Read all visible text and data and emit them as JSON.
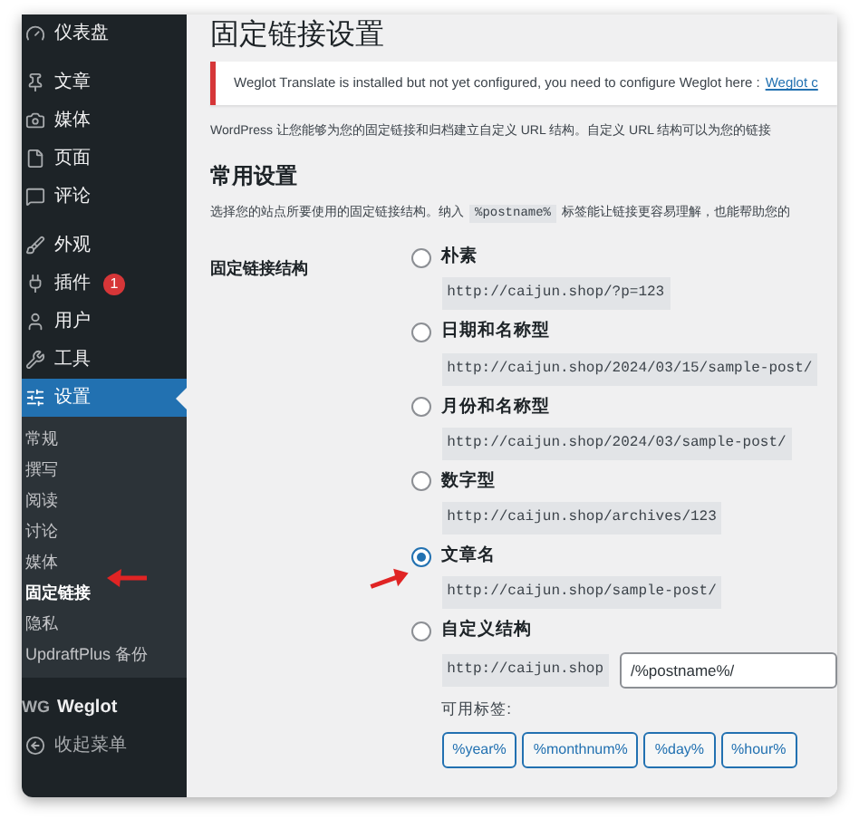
{
  "sidebar": {
    "groups": [
      [
        {
          "label": "仪表盘",
          "selected": false
        }
      ],
      [
        {
          "label": "文章",
          "selected": false
        },
        {
          "label": "媒体",
          "selected": false
        },
        {
          "label": "页面",
          "selected": false
        },
        {
          "label": "评论",
          "selected": false
        }
      ],
      [
        {
          "label": "外观",
          "selected": false
        },
        {
          "label": "插件",
          "selected": false,
          "badge": "1"
        },
        {
          "label": "用户",
          "selected": false
        },
        {
          "label": "工具",
          "selected": false
        },
        {
          "label": "设置",
          "selected": true
        }
      ]
    ],
    "submenu": [
      {
        "label": "常规",
        "selected": false
      },
      {
        "label": "撰写",
        "selected": false
      },
      {
        "label": "阅读",
        "selected": false
      },
      {
        "label": "讨论",
        "selected": false
      },
      {
        "label": "媒体",
        "selected": false
      },
      {
        "label": "固定链接",
        "selected": true
      },
      {
        "label": "隐私",
        "selected": false
      },
      {
        "label": "UpdraftPlus 备份",
        "selected": false
      }
    ],
    "weglot": {
      "logo": "WG",
      "label": "Weglot"
    },
    "collapse": "收起菜单"
  },
  "page": {
    "title": "固定链接设置",
    "notice": {
      "text": "Weglot Translate is installed but not yet configured, you need to configure Weglot here :",
      "link": "Weglot c"
    },
    "description": "WordPress 让您能够为您的固定链接和归档建立自定义 URL 结构。自定义 URL 结构可以为您的链接",
    "section_title": "常用设置",
    "instruction_before": "选择您的站点所要使用的固定链接结构。纳入",
    "instruction_code": "%postname%",
    "instruction_after": "标签能让链接更容易理解，也能帮助您的",
    "field_label": "固定链接结构",
    "options": [
      {
        "kind": "preset",
        "label": "朴素",
        "example": "http://caijun.shop/?p=123",
        "selected": false
      },
      {
        "kind": "preset",
        "label": "日期和名称型",
        "example": "http://caijun.shop/2024/03/15/sample-post/",
        "selected": false
      },
      {
        "kind": "preset",
        "label": "月份和名称型",
        "example": "http://caijun.shop/2024/03/sample-post/",
        "selected": false
      },
      {
        "kind": "preset",
        "label": "数字型",
        "example": "http://caijun.shop/archives/123",
        "selected": false
      },
      {
        "kind": "preset",
        "label": "文章名",
        "example": "http://caijun.shop/sample-post/",
        "selected": true
      },
      {
        "kind": "custom",
        "label": "自定义结构",
        "example": "http://caijun.shop",
        "value": "/%postname%/",
        "selected": false
      }
    ],
    "tags_label": "可用标签:",
    "tags": [
      "%year%",
      "%monthnum%",
      "%day%",
      "%hour%"
    ]
  }
}
